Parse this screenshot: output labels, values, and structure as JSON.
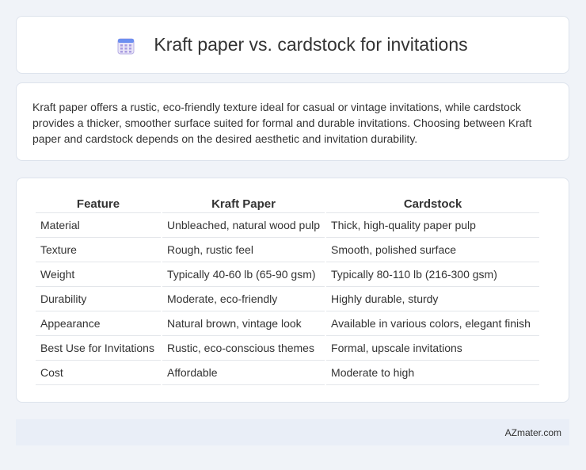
{
  "header": {
    "title": "Kraft paper vs. cardstock for invitations",
    "icon": "calendar-icon"
  },
  "description": "Kraft paper offers a rustic, eco-friendly texture ideal for casual or vintage invitations, while cardstock provides a thicker, smoother surface suited for formal and durable invitations. Choosing between Kraft paper and cardstock depends on the desired aesthetic and invitation durability.",
  "table": {
    "headers": [
      "Feature",
      "Kraft Paper",
      "Cardstock"
    ],
    "rows": [
      [
        "Material",
        "Unbleached, natural wood pulp",
        "Thick, high-quality paper pulp"
      ],
      [
        "Texture",
        "Rough, rustic feel",
        "Smooth, polished surface"
      ],
      [
        "Weight",
        "Typically 40-60 lb (65-90 gsm)",
        "Typically 80-110 lb (216-300 gsm)"
      ],
      [
        "Durability",
        "Moderate, eco-friendly",
        "Highly durable, sturdy"
      ],
      [
        "Appearance",
        "Natural brown, vintage look",
        "Available in various colors, elegant finish"
      ],
      [
        "Best Use for Invitations",
        "Rustic, eco-conscious themes",
        "Formal, upscale invitations"
      ],
      [
        "Cost",
        "Affordable",
        "Moderate to high"
      ]
    ]
  },
  "footer": {
    "brand": "AZmater.com"
  }
}
